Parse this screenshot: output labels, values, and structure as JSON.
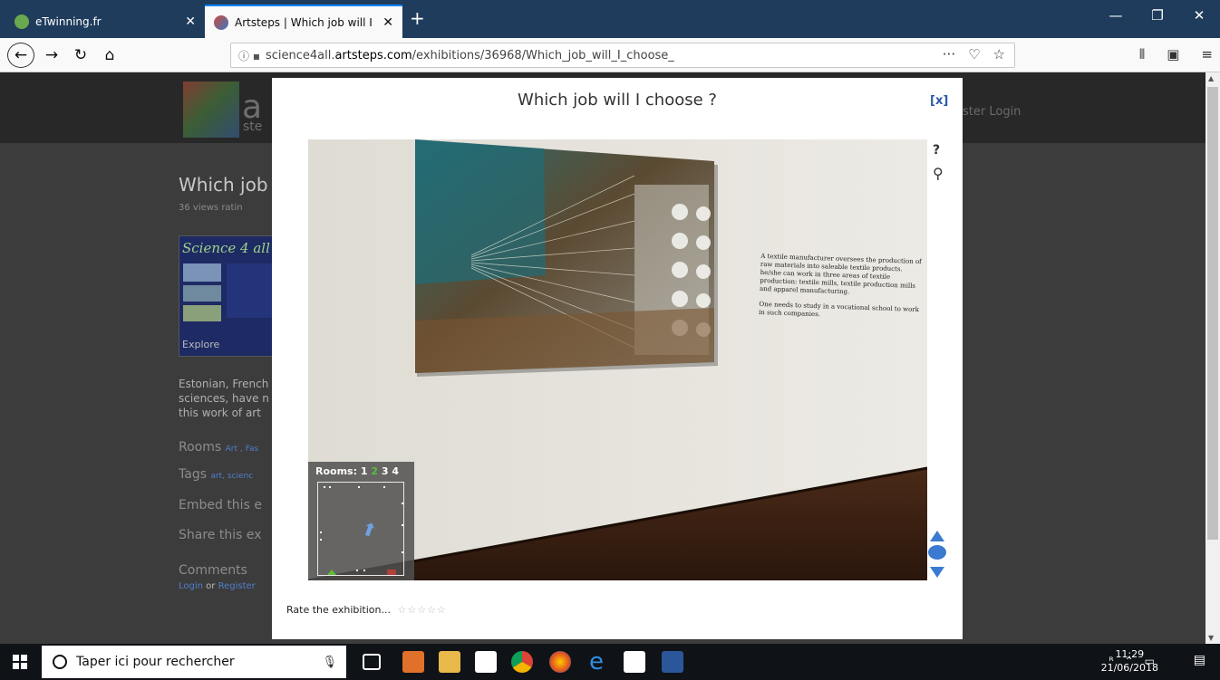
{
  "browser": {
    "tabs": [
      {
        "label": "eTwinning.fr",
        "active": false
      },
      {
        "label": "Artsteps | Which job will I choo",
        "active": true
      }
    ],
    "new_tab": "+",
    "url": {
      "prefix": "science4all.",
      "domain": "artsteps.com",
      "path": "/exhibitions/36968/Which_job_will_I_choose_"
    },
    "icons": [
      "back-icon",
      "forward-icon",
      "reload-icon",
      "home-icon",
      "more-icon",
      "pocket-icon",
      "bookmark-star-icon",
      "library-icon",
      "sidebar-icon",
      "menu-icon"
    ]
  },
  "background_page": {
    "logo_text": "a",
    "logo_sub": "ste",
    "header_link": "ster  Login",
    "title": "Which job ",
    "meta": "36 views    ratin",
    "thumb_title": "Science 4 all",
    "thumb_explore": "Explore",
    "description": "Estonian, French sciences, have n this work of art",
    "rooms_label": "Rooms",
    "rooms_links": "Art , Fas",
    "tags_label": "Tags",
    "tags_links": "art, scienc",
    "embed": "Embed this e",
    "share": "Share this ex",
    "comments": "Comments",
    "login": "Login",
    "or": "or",
    "register": "Register"
  },
  "modal": {
    "title": "Which job will I choose ?",
    "close": "[x]",
    "wall_text_1": "A textile manufacturer oversees the production of raw materials into saleable textile products. he/she can work in three areas of textile production: textile mills, textile production mills and apparel manufacturing.",
    "wall_text_2": "One needs to study in a vocational school to work in such companies.",
    "minimap": {
      "rooms_label": "Rooms:",
      "rooms": [
        "1",
        "2",
        "3",
        "4"
      ],
      "current_room": "2"
    },
    "help": "?",
    "rate_label": "Rate the exhibition...",
    "stars": "☆☆☆☆☆",
    "colors": {
      "accent": "#3a7ad0",
      "current_room": "#5bbf3a"
    }
  },
  "taskbar": {
    "search_placeholder": "Taper ici pour rechercher",
    "apps": [
      "task-view-icon",
      "outlook-icon",
      "file-explorer-icon",
      "store-icon",
      "chrome-icon",
      "firefox-icon",
      "edge-icon",
      "app-icon",
      "word-icon"
    ],
    "time": "11:29",
    "date": "21/06/2018"
  }
}
